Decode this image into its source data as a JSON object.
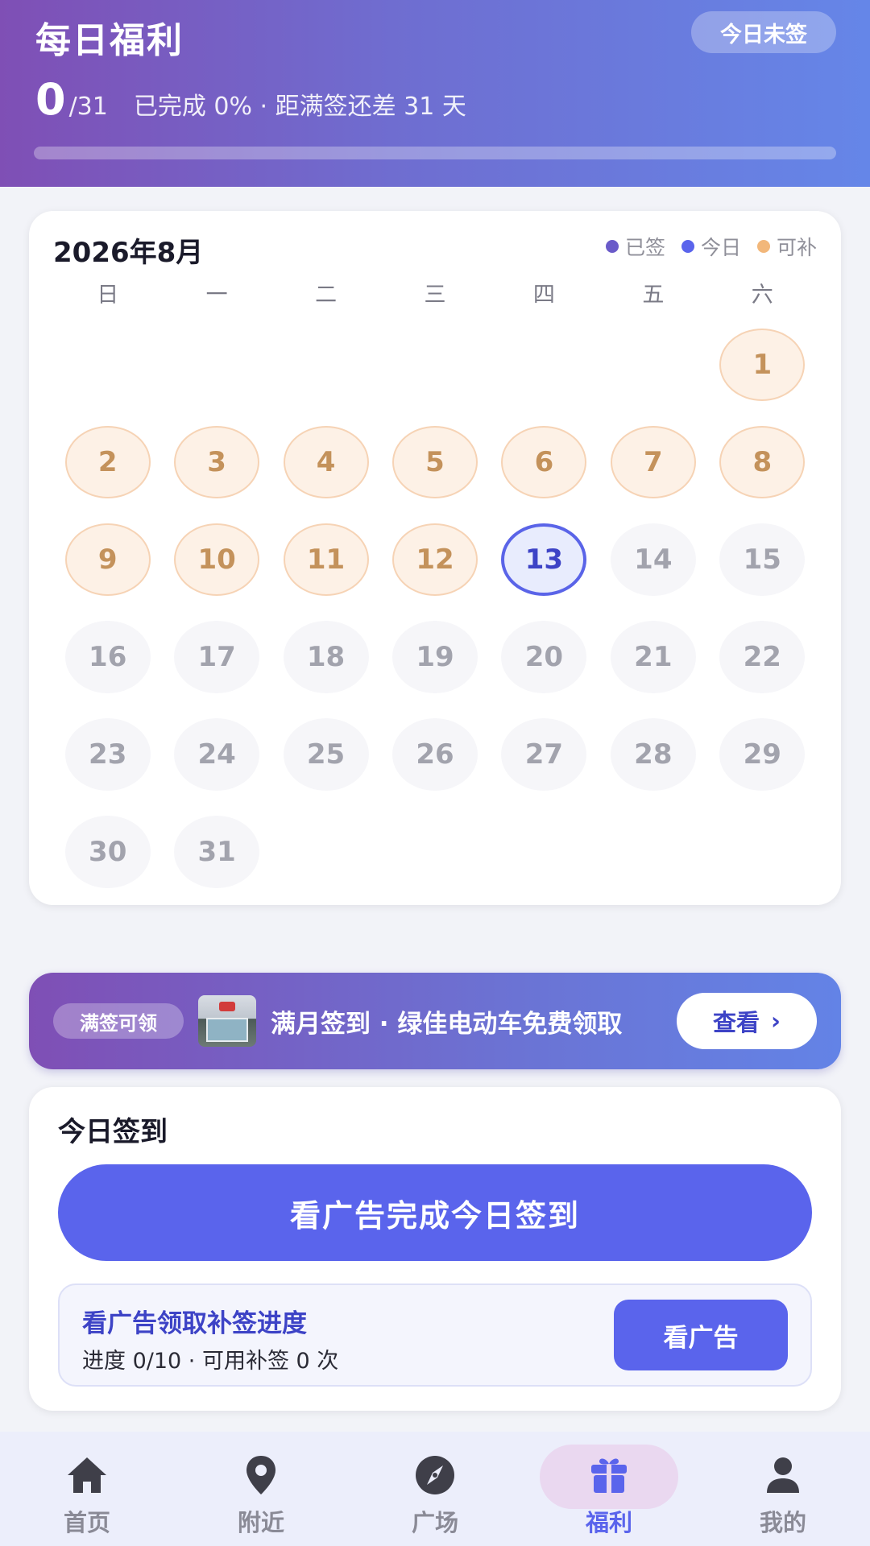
{
  "header": {
    "title": "每日福利",
    "status": "今日未签",
    "progress_count": "0",
    "progress_total": "/31",
    "progress_desc": "已完成 0% · 距满签还差 31 天",
    "progress_fraction": 0
  },
  "calendar": {
    "month_label": "2026年8月",
    "legend": [
      {
        "label": "已签",
        "color": "#6a5bc9"
      },
      {
        "label": "今日",
        "color": "#5a64ec"
      },
      {
        "label": "可补",
        "color": "#f2b77a"
      }
    ],
    "weekdays": [
      "日",
      "一",
      "二",
      "三",
      "四",
      "五",
      "六"
    ],
    "leading_blanks": 6,
    "days": [
      {
        "day": "1",
        "state": "makeup"
      },
      {
        "day": "2",
        "state": "makeup"
      },
      {
        "day": "3",
        "state": "makeup"
      },
      {
        "day": "4",
        "state": "makeup"
      },
      {
        "day": "5",
        "state": "makeup"
      },
      {
        "day": "6",
        "state": "makeup"
      },
      {
        "day": "7",
        "state": "makeup"
      },
      {
        "day": "8",
        "state": "makeup"
      },
      {
        "day": "9",
        "state": "makeup"
      },
      {
        "day": "10",
        "state": "makeup"
      },
      {
        "day": "11",
        "state": "makeup"
      },
      {
        "day": "12",
        "state": "makeup"
      },
      {
        "day": "13",
        "state": "today"
      },
      {
        "day": "14",
        "state": "future"
      },
      {
        "day": "15",
        "state": "future"
      },
      {
        "day": "16",
        "state": "future"
      },
      {
        "day": "17",
        "state": "future"
      },
      {
        "day": "18",
        "state": "future"
      },
      {
        "day": "19",
        "state": "future"
      },
      {
        "day": "20",
        "state": "future"
      },
      {
        "day": "21",
        "state": "future"
      },
      {
        "day": "22",
        "state": "future"
      },
      {
        "day": "23",
        "state": "future"
      },
      {
        "day": "24",
        "state": "future"
      },
      {
        "day": "25",
        "state": "future"
      },
      {
        "day": "26",
        "state": "future"
      },
      {
        "day": "27",
        "state": "future"
      },
      {
        "day": "28",
        "state": "future"
      },
      {
        "day": "29",
        "state": "future"
      },
      {
        "day": "30",
        "state": "future"
      },
      {
        "day": "31",
        "state": "future"
      }
    ]
  },
  "reward_banner": {
    "tag": "满签可领",
    "text": "满月签到 · 绿佳电动车免费领取",
    "button_label": "查看",
    "button_arrow": "›"
  },
  "sign_card": {
    "title": "今日签到",
    "main_button": "看广告完成今日签到",
    "makeup_title": "看广告领取补签进度",
    "makeup_desc": "进度 0/10 · 可用补签 0 次",
    "makeup_button": "看广告"
  },
  "bottom_nav": {
    "items": [
      {
        "label": "首页",
        "icon": "home-icon",
        "active": false
      },
      {
        "label": "附近",
        "icon": "location-pin-icon",
        "active": false
      },
      {
        "label": "广场",
        "icon": "compass-icon",
        "active": false
      },
      {
        "label": "福利",
        "icon": "gift-icon",
        "active": true
      },
      {
        "label": "我的",
        "icon": "user-icon",
        "active": false
      }
    ]
  },
  "colors": {
    "accent": "#5a64ec",
    "makeup": "#f2b77a",
    "header_gradient_start": "#7f4fb5",
    "header_gradient_end": "#6586e8"
  }
}
